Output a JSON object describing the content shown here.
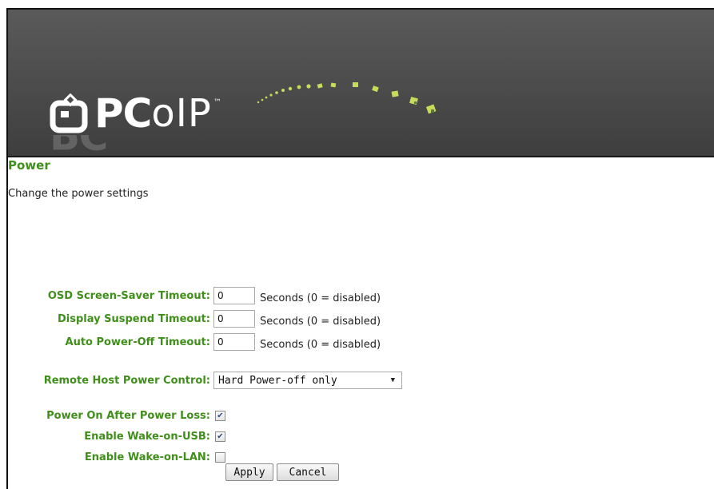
{
  "header": {
    "logo_text_pc": "PC",
    "logo_text_oip": "oIP",
    "logo_tm": "™",
    "background_color": "#4b4b4b",
    "accent_color": "#c8dc5a"
  },
  "page": {
    "title": "Power",
    "description": "Change the power settings",
    "title_color": "#3f8f1a"
  },
  "fields": {
    "osd_timeout": {
      "label": "OSD Screen-Saver Timeout:",
      "value": "0",
      "unit": "Seconds (0 = disabled)"
    },
    "display_suspend": {
      "label": "Display Suspend Timeout:",
      "value": "0",
      "unit": "Seconds (0 = disabled)"
    },
    "auto_power_off": {
      "label": "Auto Power-Off Timeout:",
      "value": "0",
      "unit": "Seconds (0 = disabled)"
    },
    "remote_host_power": {
      "label": "Remote Host Power Control:",
      "selected": "Hard Power-off only"
    },
    "power_on_after_loss": {
      "label": "Power On After Power Loss:",
      "checked": true
    },
    "wake_on_usb": {
      "label": "Enable Wake-on-USB:",
      "checked": true
    },
    "wake_on_lan": {
      "label": "Enable Wake-on-LAN:",
      "checked": false
    }
  },
  "buttons": {
    "apply": "Apply",
    "cancel": "Cancel"
  }
}
